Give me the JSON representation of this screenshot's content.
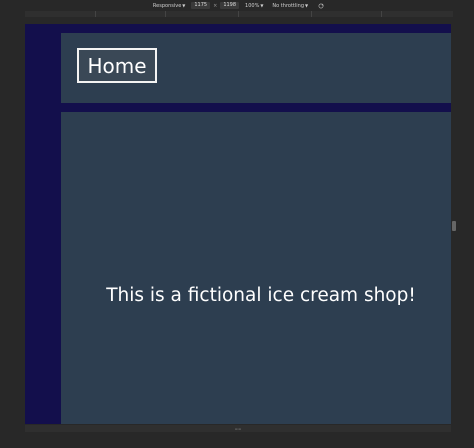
{
  "devtools": {
    "device_mode": "Responsive",
    "width": "1175",
    "times": "×",
    "height": "1198",
    "zoom": "100%",
    "throttling": "No throttling",
    "rotate_icon": "rotate-icon",
    "resize_handle": "=="
  },
  "page": {
    "nav": {
      "home_label": "Home"
    },
    "main": {
      "tagline": "This is a fictional ice cream shop!"
    }
  },
  "colors": {
    "sidebar": "#130f4c",
    "panel": "#2d3e50",
    "button_border": "#f3f3f3",
    "text": "#ffffff"
  }
}
